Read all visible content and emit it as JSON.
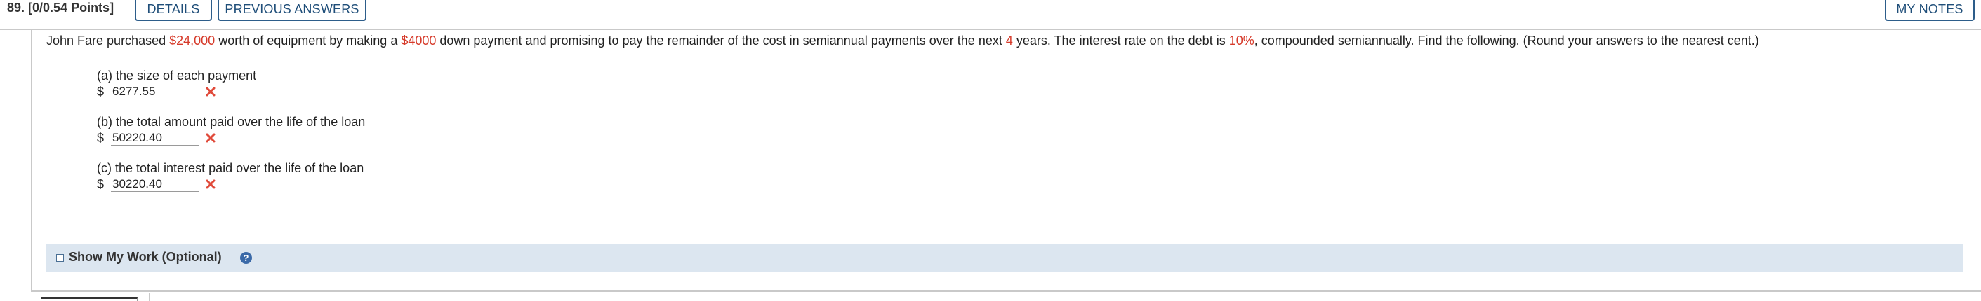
{
  "header": {
    "points": "89. [0/0.54 Points]",
    "details_label": "DETAILS",
    "previous_answers_label": "PREVIOUS ANSWERS",
    "my_notes_label": "MY NOTES"
  },
  "question": {
    "t1": "John Fare purchased ",
    "price": "$24,000",
    "t2": " worth of equipment by making a ",
    "down_payment": "$4000",
    "t3": " down payment and promising to pay the remainder of the cost in semiannual payments over the next ",
    "years": "4",
    "t4": " years. The interest rate on the debt is ",
    "rate": "10%",
    "t5": ", compounded semiannually. Find the following. (Round your answers to the nearest cent.)"
  },
  "parts": [
    {
      "label": "(a) the size of each payment",
      "currency": "$",
      "value": "6277.55"
    },
    {
      "label": "(b) the total amount paid over the life of the loan",
      "currency": "$",
      "value": "50220.40"
    },
    {
      "label": "(c) the total interest paid over the life of the loan",
      "currency": "$",
      "value": "30220.40"
    }
  ],
  "show_my_work": {
    "label": "Show My Work (Optional)",
    "help_glyph": "?"
  },
  "colors": {
    "accent_red": "#d63a2a",
    "tab_border": "#2d5d8a",
    "show_work_bg": "#dce6f0",
    "help_icon_bg": "#3b6aa8",
    "wrong_mark": "#e04a3a"
  },
  "icons": {
    "wrong": "incorrect-x-icon",
    "toggle": "expand-plus-icon",
    "help": "help-question-icon"
  }
}
